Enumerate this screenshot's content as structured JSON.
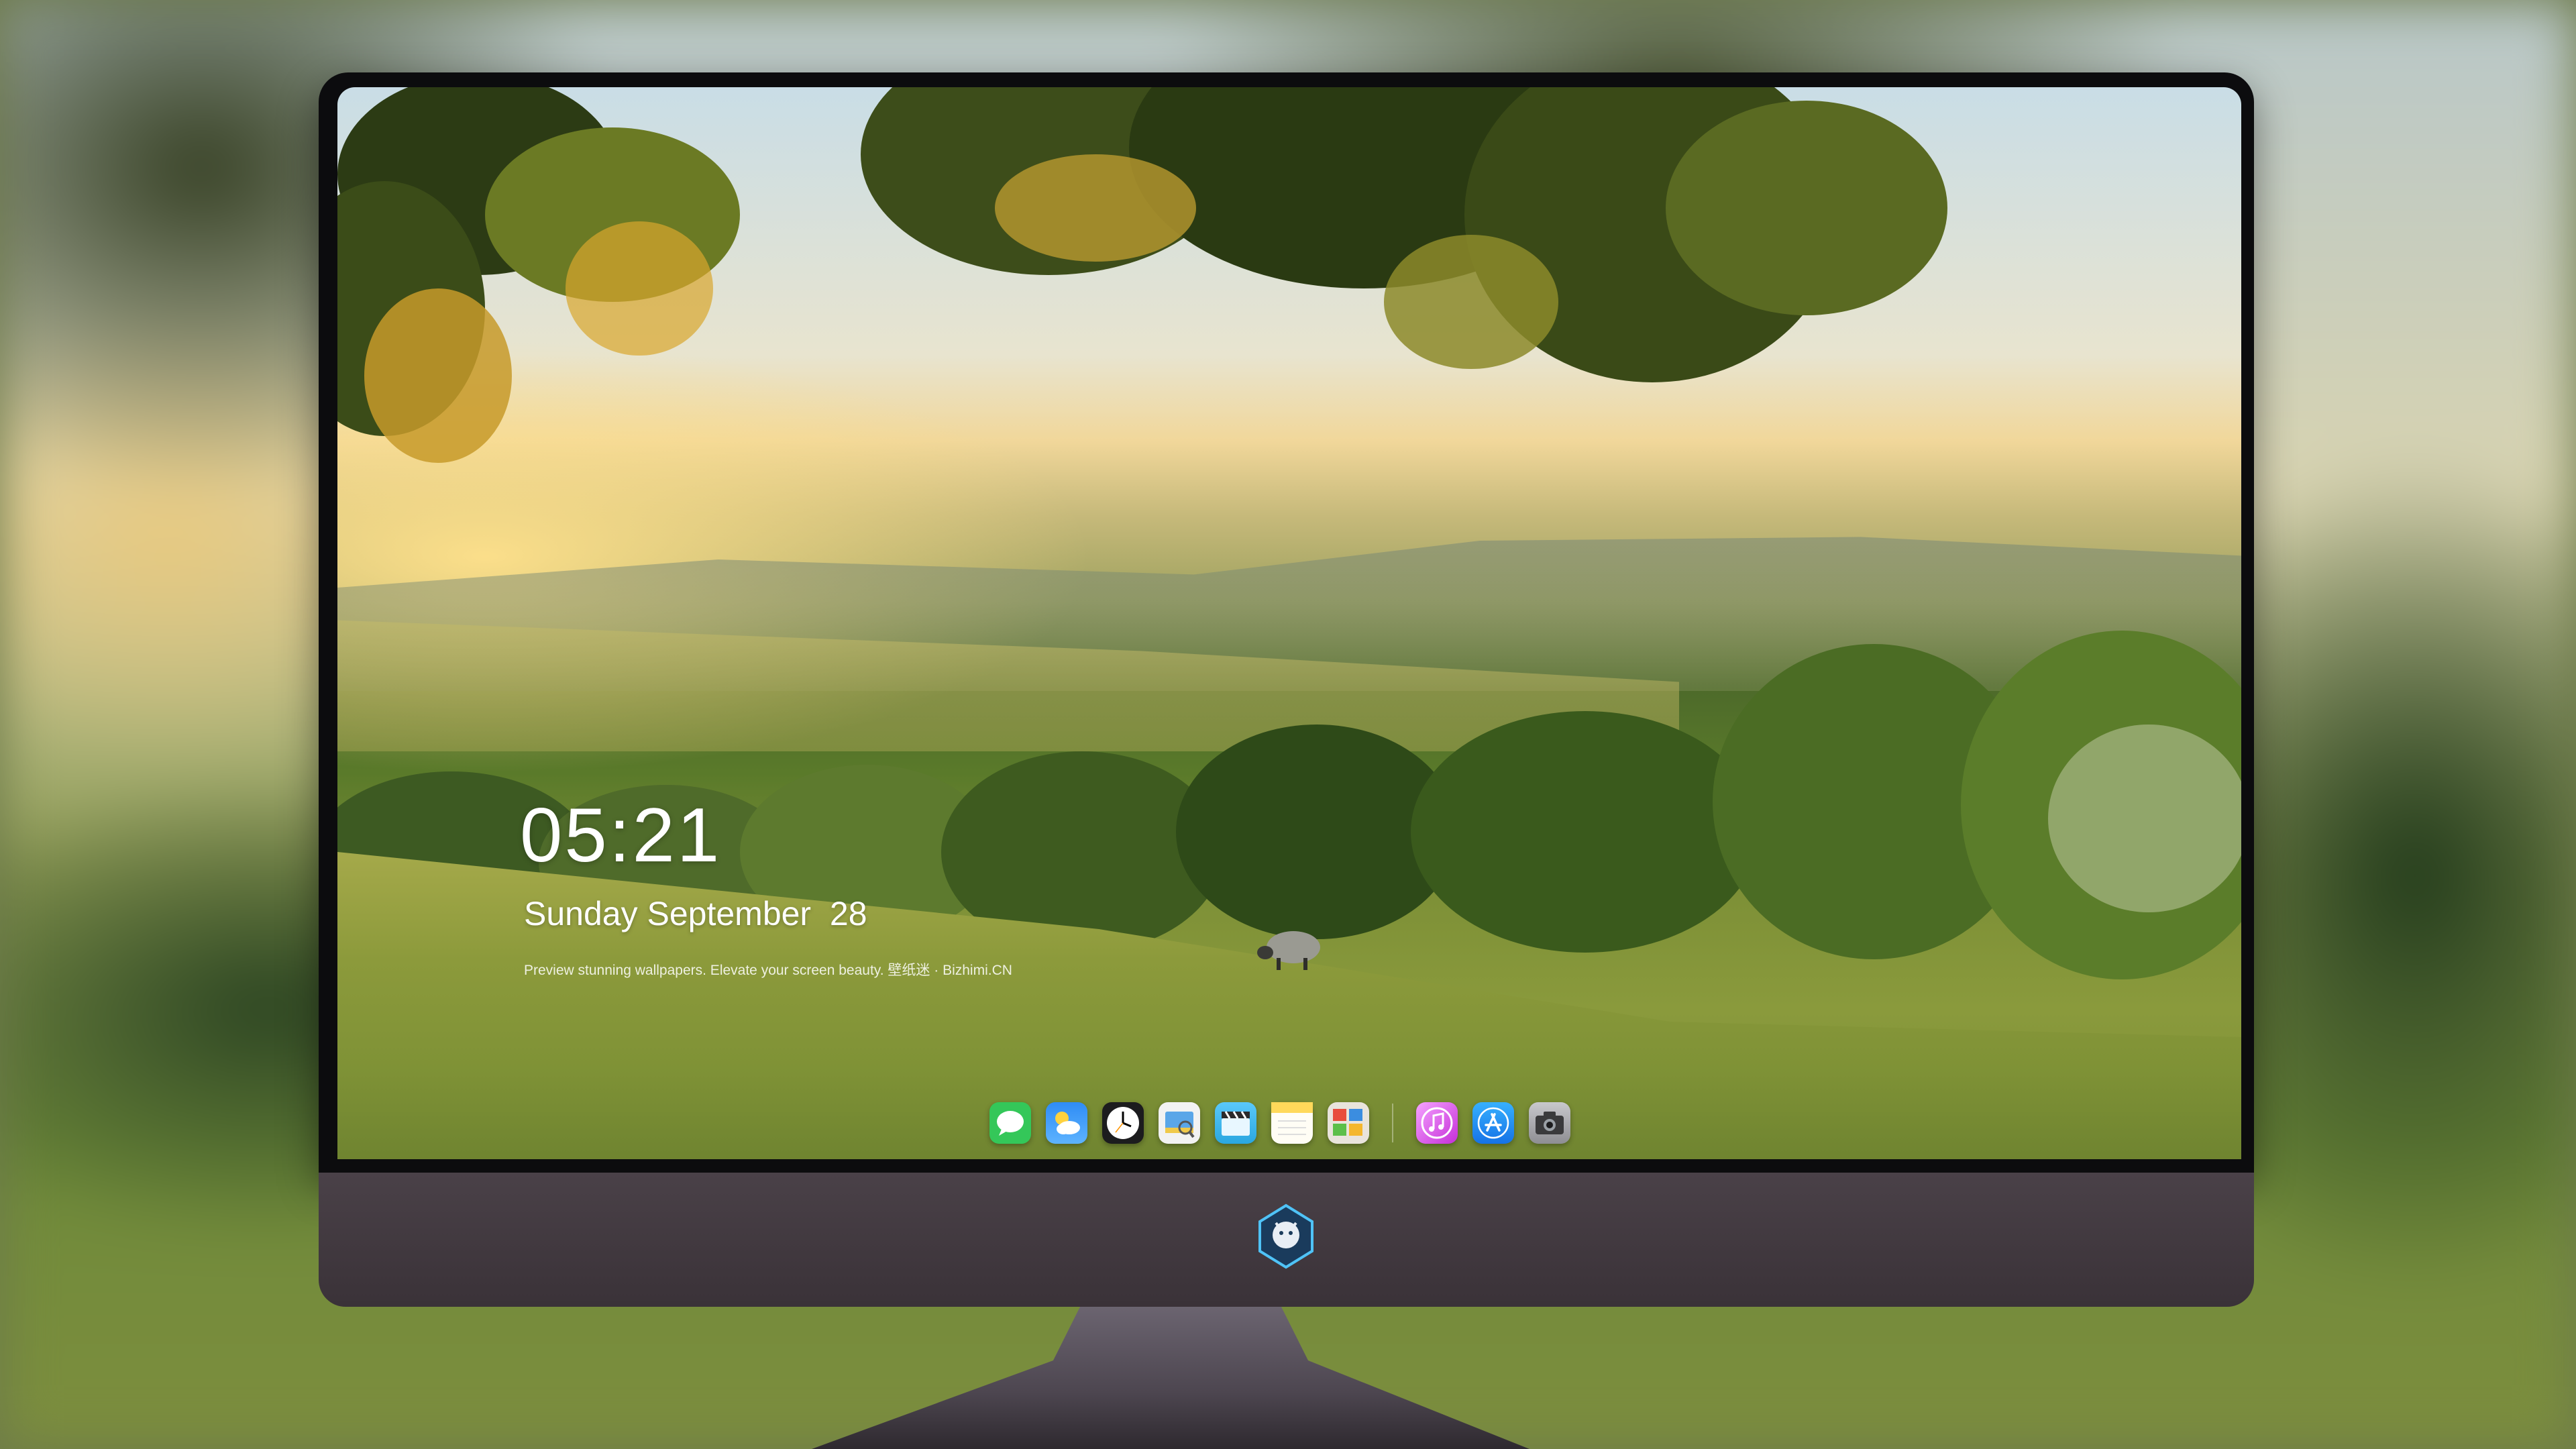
{
  "lock_screen": {
    "time": "05:21",
    "weekday": "Sunday",
    "month": "September",
    "day": "28",
    "caption": "Preview stunning wallpapers. Elevate your screen beauty. 壁纸迷 · Bizhimi.CN"
  },
  "dock": {
    "apps": [
      {
        "icon": "messages-icon",
        "color": "#34c759"
      },
      {
        "icon": "weather-icon",
        "color": "#2f8cf5"
      },
      {
        "icon": "clock-icon",
        "color": "#1c1c1e"
      },
      {
        "icon": "preview-icon",
        "color": "#f0c94a"
      },
      {
        "icon": "clips-icon",
        "color": "#5ac8fa"
      },
      {
        "icon": "notes-icon",
        "color": "#ffd95a"
      },
      {
        "icon": "photo-booth-icon",
        "color": "#e9e4dc"
      },
      {
        "icon": "itunes-icon",
        "color": "#e040c8"
      },
      {
        "icon": "app-store-icon",
        "color": "#1e8df5"
      },
      {
        "icon": "camera-icon",
        "color": "#8e8e93"
      }
    ]
  },
  "colors": {
    "monitor_chin": "#3f363d",
    "bezel": "#0c0c0e",
    "text": "#ffffff"
  }
}
